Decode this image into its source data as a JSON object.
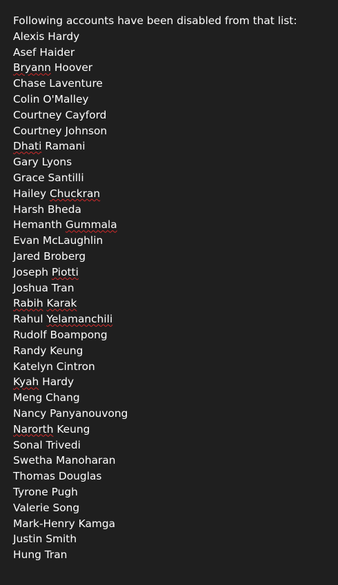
{
  "document": {
    "heading": "Following accounts have been disabled from that list:",
    "names": [
      {
        "parts": [
          {
            "text": "Alexis Hardy",
            "flag": false
          }
        ]
      },
      {
        "parts": [
          {
            "text": "Asef Haider",
            "flag": false
          }
        ]
      },
      {
        "parts": [
          {
            "text": "Bryann",
            "flag": true
          },
          {
            "text": " Hoover",
            "flag": false
          }
        ]
      },
      {
        "parts": [
          {
            "text": "Chase Laventure",
            "flag": false
          }
        ]
      },
      {
        "parts": [
          {
            "text": "Colin O'Malley",
            "flag": false
          }
        ]
      },
      {
        "parts": [
          {
            "text": "Courtney Cayford",
            "flag": false
          }
        ]
      },
      {
        "parts": [
          {
            "text": "Courtney Johnson",
            "flag": false
          }
        ]
      },
      {
        "parts": [
          {
            "text": "Dhati",
            "flag": true
          },
          {
            "text": " Ramani",
            "flag": false
          }
        ]
      },
      {
        "parts": [
          {
            "text": "Gary Lyons",
            "flag": false
          }
        ]
      },
      {
        "parts": [
          {
            "text": "Grace Santilli",
            "flag": false
          }
        ]
      },
      {
        "parts": [
          {
            "text": "Hailey ",
            "flag": false
          },
          {
            "text": "Chuckran",
            "flag": true
          }
        ]
      },
      {
        "parts": [
          {
            "text": "Harsh Bheda",
            "flag": false
          }
        ]
      },
      {
        "parts": [
          {
            "text": "Hemanth ",
            "flag": false
          },
          {
            "text": "Gummala",
            "flag": true
          }
        ]
      },
      {
        "parts": [
          {
            "text": "Evan McLaughlin",
            "flag": false
          }
        ]
      },
      {
        "parts": [
          {
            "text": "Jared Broberg",
            "flag": false
          }
        ]
      },
      {
        "parts": [
          {
            "text": "Joseph ",
            "flag": false
          },
          {
            "text": "Piotti",
            "flag": true
          }
        ]
      },
      {
        "parts": [
          {
            "text": "Joshua Tran",
            "flag": false
          }
        ]
      },
      {
        "parts": [
          {
            "text": "Rabih",
            "flag": true
          },
          {
            "text": " ",
            "flag": false
          },
          {
            "text": "Karak",
            "flag": true
          }
        ]
      },
      {
        "parts": [
          {
            "text": "Rahul ",
            "flag": false
          },
          {
            "text": "Yelamanchili",
            "flag": true
          }
        ]
      },
      {
        "parts": [
          {
            "text": "Rudolf Boampong",
            "flag": false
          }
        ]
      },
      {
        "parts": [
          {
            "text": "Randy Keung",
            "flag": false
          }
        ]
      },
      {
        "parts": [
          {
            "text": "Katelyn Cintron",
            "flag": false
          }
        ]
      },
      {
        "parts": [
          {
            "text": "Kyah",
            "flag": true
          },
          {
            "text": " Hardy",
            "flag": false
          }
        ]
      },
      {
        "parts": [
          {
            "text": "Meng Chang",
            "flag": false
          }
        ]
      },
      {
        "parts": [
          {
            "text": "Nancy Panyanouvong",
            "flag": false
          }
        ]
      },
      {
        "parts": [
          {
            "text": "Narorth",
            "flag": true
          },
          {
            "text": " Keung",
            "flag": false
          }
        ]
      },
      {
        "parts": [
          {
            "text": "Sonal Trivedi",
            "flag": false
          }
        ]
      },
      {
        "parts": [
          {
            "text": "Swetha Manoharan",
            "flag": false
          }
        ]
      },
      {
        "parts": [
          {
            "text": "Thomas Douglas",
            "flag": false
          }
        ]
      },
      {
        "parts": [
          {
            "text": "Tyrone Pugh",
            "flag": false
          }
        ]
      },
      {
        "parts": [
          {
            "text": "Valerie Song",
            "flag": false
          }
        ]
      },
      {
        "parts": [
          {
            "text": "Mark-Henry Kamga",
            "flag": false
          }
        ]
      },
      {
        "parts": [
          {
            "text": "Justin Smith",
            "flag": false
          }
        ]
      },
      {
        "parts": [
          {
            "text": "Hung Tran",
            "flag": false
          }
        ]
      }
    ]
  },
  "colors": {
    "background": "#1f1f1f",
    "text": "#ffffff",
    "spellcheck_underline": "#d42a2a"
  }
}
